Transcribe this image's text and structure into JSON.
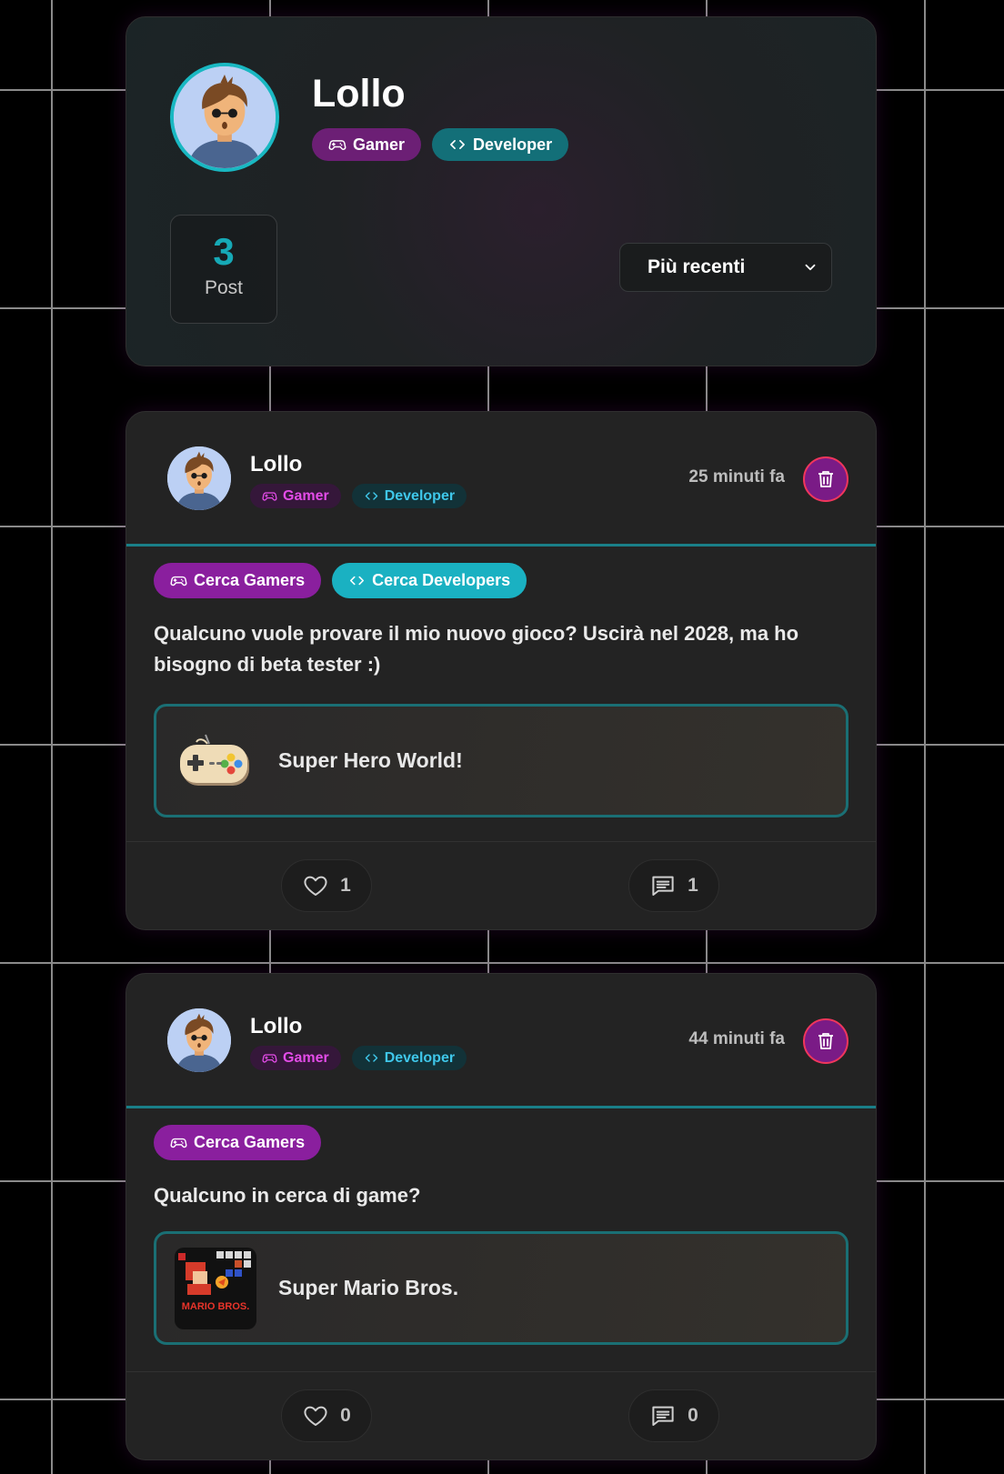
{
  "profile": {
    "name": "Lollo",
    "badges": {
      "gamer": "Gamer",
      "developer": "Developer"
    },
    "stats": {
      "posts_count": "3",
      "posts_label": "Post"
    },
    "sort": {
      "selected": "Più recenti"
    }
  },
  "posts": [
    {
      "author": "Lollo",
      "badges": {
        "gamer": "Gamer",
        "developer": "Developer"
      },
      "time": "25 minuti fa",
      "tags": {
        "gamer": "Cerca Gamers",
        "developer": "Cerca Developers"
      },
      "text": "Qualcuno vuole provare il mio nuovo gioco? Uscirà nel 2028, ma ho bisogno di beta tester :)",
      "game": {
        "title": "Super Hero World!",
        "icon": "gamepad-icon"
      },
      "likes": "1",
      "comments": "1"
    },
    {
      "author": "Lollo",
      "badges": {
        "gamer": "Gamer",
        "developer": "Developer"
      },
      "time": "44 minuti fa",
      "tags": {
        "gamer": "Cerca Gamers"
      },
      "text": "Qualcuno in cerca di game?",
      "game": {
        "title": "Super Mario Bros.",
        "cover_text": "MARIO BROS.",
        "icon": "game-cover"
      },
      "likes": "0",
      "comments": "0"
    }
  ],
  "colors": {
    "accent_teal": "#16a9b6",
    "accent_purple": "#8a1f9e",
    "delete_border": "#f0365c"
  }
}
